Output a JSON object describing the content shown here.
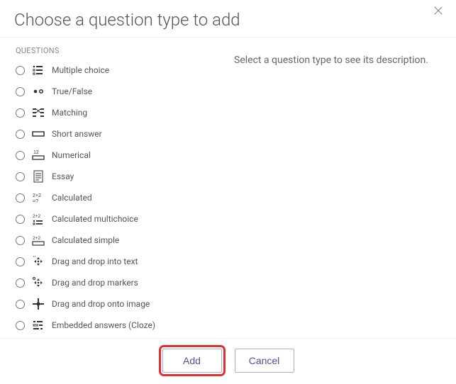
{
  "dialog": {
    "title": "Choose a question type to add",
    "close_aria": "Close"
  },
  "left": {
    "section_label": "QUESTIONS",
    "types": [
      {
        "id": "multichoice",
        "label": "Multiple choice",
        "icon": "multichoice-icon"
      },
      {
        "id": "truefalse",
        "label": "True/False",
        "icon": "truefalse-icon"
      },
      {
        "id": "matching",
        "label": "Matching",
        "icon": "matching-icon"
      },
      {
        "id": "shortanswer",
        "label": "Short answer",
        "icon": "shortanswer-icon"
      },
      {
        "id": "numerical",
        "label": "Numerical",
        "icon": "numerical-icon"
      },
      {
        "id": "essay",
        "label": "Essay",
        "icon": "essay-icon"
      },
      {
        "id": "calculated",
        "label": "Calculated",
        "icon": "calculated-icon"
      },
      {
        "id": "calculatedmulti",
        "label": "Calculated multichoice",
        "icon": "calculatedmulti-icon"
      },
      {
        "id": "calculatedsimple",
        "label": "Calculated simple",
        "icon": "calculatedsimple-icon"
      },
      {
        "id": "ddwtos",
        "label": "Drag and drop into text",
        "icon": "ddwtos-icon"
      },
      {
        "id": "ddmarker",
        "label": "Drag and drop markers",
        "icon": "ddmarker-icon"
      },
      {
        "id": "ddimageortext",
        "label": "Drag and drop onto image",
        "icon": "ddimageortext-icon"
      },
      {
        "id": "cloze",
        "label": "Embedded answers (Cloze)",
        "icon": "cloze-icon"
      }
    ]
  },
  "right": {
    "placeholder": "Select a question type to see its description."
  },
  "footer": {
    "add_label": "Add",
    "cancel_label": "Cancel"
  }
}
